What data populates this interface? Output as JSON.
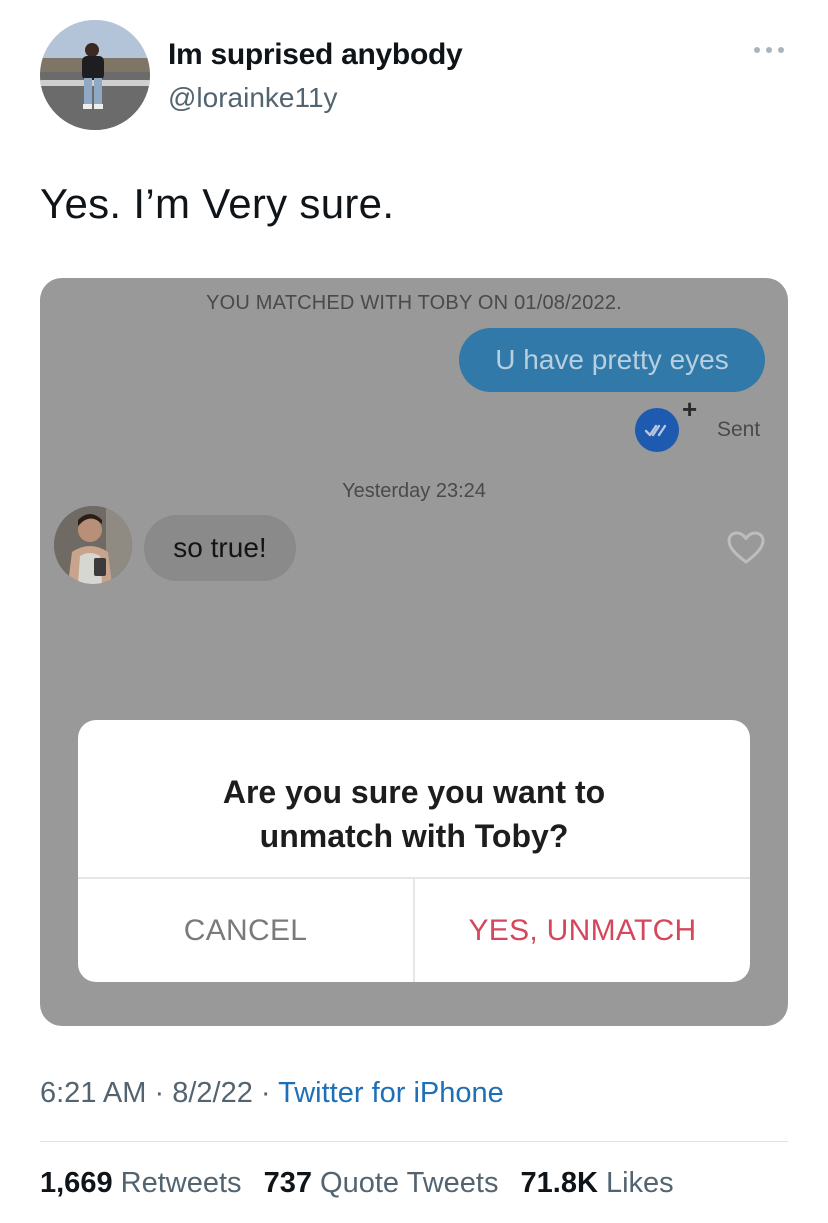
{
  "tweet": {
    "author_name": "Im suprised anybody",
    "author_handle": "@lorainke11y",
    "text": "Yes. I’m Very sure.",
    "time": "6:21 AM",
    "separator": "·",
    "date": "8/2/22",
    "source": "Twitter for iPhone"
  },
  "stats": {
    "retweets_count": "1,669",
    "retweets_label": "Retweets",
    "quotes_count": "737",
    "quotes_label": "Quote Tweets",
    "likes_count": "71.8K",
    "likes_label": "Likes"
  },
  "screenshot": {
    "match_notice": "YOU MATCHED WITH TOBY ON 01/08/2022.",
    "sent_message": "U have pretty eyes",
    "read_receipt_plus": "+",
    "sent_status": "Sent",
    "timestamp": "Yesterday 23:24",
    "received_message": "so true!",
    "dialog": {
      "line1": "Are you sure you want to",
      "line2": "unmatch with Toby?",
      "cancel_label": "CANCEL",
      "confirm_label": "YES, UNMATCH"
    }
  },
  "icons": {
    "more": "more-horizontal-icon",
    "read_receipt": "double-check-icon",
    "heart": "heart-outline-icon"
  },
  "colors": {
    "link": "#1d6fb8",
    "secondary_text": "#536471",
    "sent_bubble": "#3079a8",
    "confirm": "#d5475c",
    "overlay": "#999999"
  }
}
